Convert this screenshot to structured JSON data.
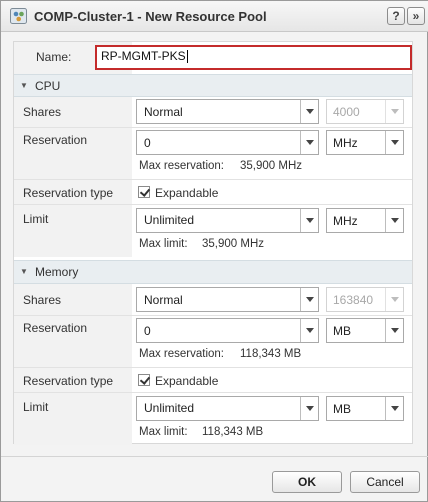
{
  "window": {
    "title": "COMP-Cluster-1 - New Resource Pool",
    "help_glyph": "?",
    "expand_glyph": "»"
  },
  "name_row": {
    "label": "Name:",
    "value": "RP-MGMT-PKS"
  },
  "cpu": {
    "section_title": "CPU",
    "shares": {
      "label": "Shares",
      "value": "Normal",
      "number": "4000"
    },
    "reservation": {
      "label": "Reservation",
      "value": "0",
      "unit": "MHz",
      "max_label": "Max reservation:",
      "max_value": "35,900 MHz"
    },
    "reservation_type": {
      "label": "Reservation type",
      "checkbox_label": "Expandable",
      "checked": true
    },
    "limit": {
      "label": "Limit",
      "value": "Unlimited",
      "unit": "MHz",
      "max_label": "Max limit:",
      "max_value": "35,900 MHz"
    }
  },
  "memory": {
    "section_title": "Memory",
    "shares": {
      "label": "Shares",
      "value": "Normal",
      "number": "163840"
    },
    "reservation": {
      "label": "Reservation",
      "value": "0",
      "unit": "MB",
      "max_label": "Max reservation:",
      "max_value": "118,343 MB"
    },
    "reservation_type": {
      "label": "Reservation type",
      "checkbox_label": "Expandable",
      "checked": true
    },
    "limit": {
      "label": "Limit",
      "value": "Unlimited",
      "unit": "MB",
      "max_label": "Max limit:",
      "max_value": "118,343 MB"
    }
  },
  "footer": {
    "ok_label": "OK",
    "cancel_label": "Cancel"
  },
  "colors": {
    "focus_border": "#c42b2b",
    "section_header": "#e9eef1",
    "label_column": "#f2f2f2"
  },
  "icons": {
    "app": "vsphere-resource-pool-icon",
    "help": "help-icon",
    "expand": "expand-icon",
    "collapse": "triangle-down-icon",
    "dropdown": "chevron-down-icon",
    "check": "check-icon"
  }
}
